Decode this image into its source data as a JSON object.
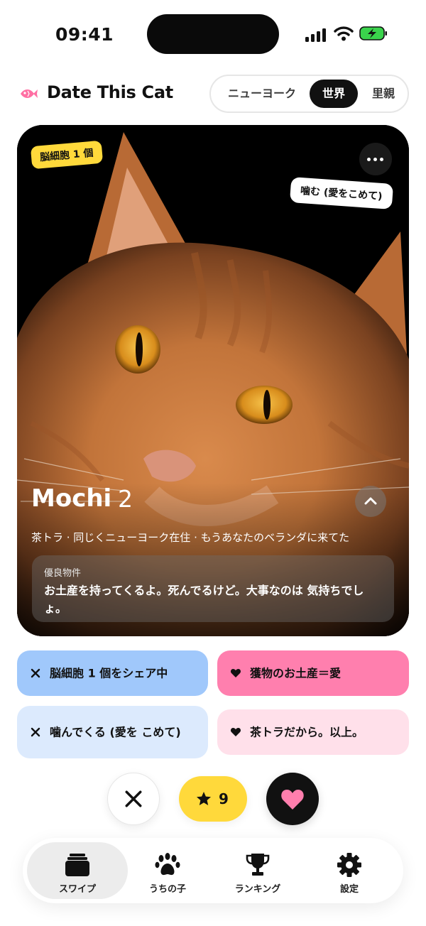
{
  "status_bar": {
    "time": "09:41"
  },
  "header": {
    "title": "Date This Cat",
    "segments": [
      {
        "label": "ニューヨーク",
        "selected": false
      },
      {
        "label": "世界",
        "selected": true
      },
      {
        "label": "里親",
        "selected": false
      }
    ]
  },
  "card": {
    "badge": "脳細胞 1 個",
    "tag": "噛む (愛をこめて)",
    "name": "Mochi",
    "age": "2",
    "description": "茶トラ · 同じくニューヨーク在住 · もうあなたのベランダに来てた",
    "info": {
      "label": "優良物件",
      "text": "お土産を持ってくるよ。死んでるけど。大事なのは 気持ちでしょ。"
    }
  },
  "chips": [
    {
      "label": "脳細胞 1 個をシェア中",
      "icon": "x-icon",
      "color": "#a0c8fb"
    },
    {
      "label": "獲物のお土産＝愛",
      "icon": "heart-icon",
      "color": "#ff7fae"
    },
    {
      "label": "噛んでくる (愛を こめて)",
      "icon": "x-icon",
      "color": "#dceafd"
    },
    {
      "label": "茶トラだから。以上。",
      "icon": "heart-icon",
      "color": "#ffe0ea"
    }
  ],
  "actions": {
    "star_count": "9"
  },
  "tabbar": {
    "tabs": [
      {
        "label": "スワイプ",
        "icon": "cards-icon",
        "active": true
      },
      {
        "label": "うちの子",
        "icon": "paw-icon",
        "active": false
      },
      {
        "label": "ランキング",
        "icon": "trophy-icon",
        "active": false
      },
      {
        "label": "設定",
        "icon": "gear-icon",
        "active": false
      }
    ]
  },
  "colors": {
    "accent_pink": "#ff7fae",
    "accent_yellow": "#ffd93b",
    "accent_blue": "#a0c8fb",
    "dark": "#111111"
  }
}
